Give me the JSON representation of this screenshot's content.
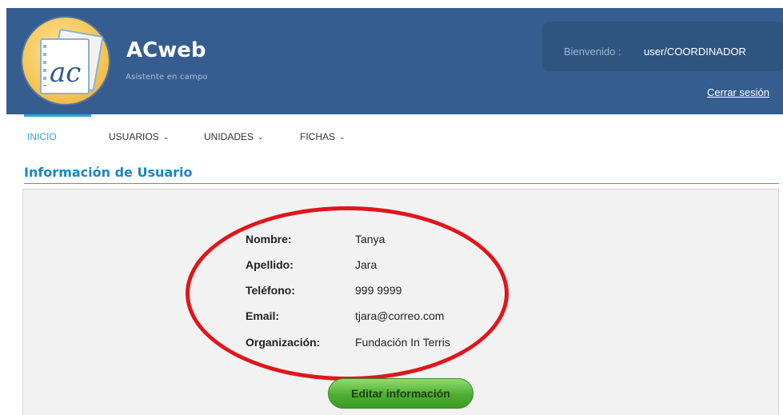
{
  "header": {
    "app_name": "ACweb",
    "tagline": "Asistente en campo",
    "logo_text": "ac",
    "welcome_label": "Bienvenido :",
    "user": "user/COORDINADOR",
    "logout": "Cerrar sesión"
  },
  "nav": {
    "items": [
      {
        "label": "INICIO",
        "active": true
      },
      {
        "label": "USUARIOS",
        "has_dropdown": true
      },
      {
        "label": "UNIDADES",
        "has_dropdown": true
      },
      {
        "label": "FICHAS",
        "has_dropdown": true
      }
    ]
  },
  "section": {
    "title": "Información de Usuario"
  },
  "user_info": {
    "fields": [
      {
        "label": "Nombre:",
        "value": "Tanya"
      },
      {
        "label": "Apellido:",
        "value": "Jara"
      },
      {
        "label": "Teléfono:",
        "value": "999 9999"
      },
      {
        "label": "Email:",
        "value": "tjara@correo.com"
      },
      {
        "label": "Organización:",
        "value": "Fundación In Terris"
      }
    ]
  },
  "actions": {
    "edit_label": "Editar información"
  },
  "colors": {
    "header_bg": "#365d8f",
    "accent": "#2aa6df",
    "section_title": "#1a86c4",
    "highlight": "#e0161b",
    "button_green": "#4fae34"
  },
  "icons": {
    "dropdown": "chevron-down-icon"
  }
}
